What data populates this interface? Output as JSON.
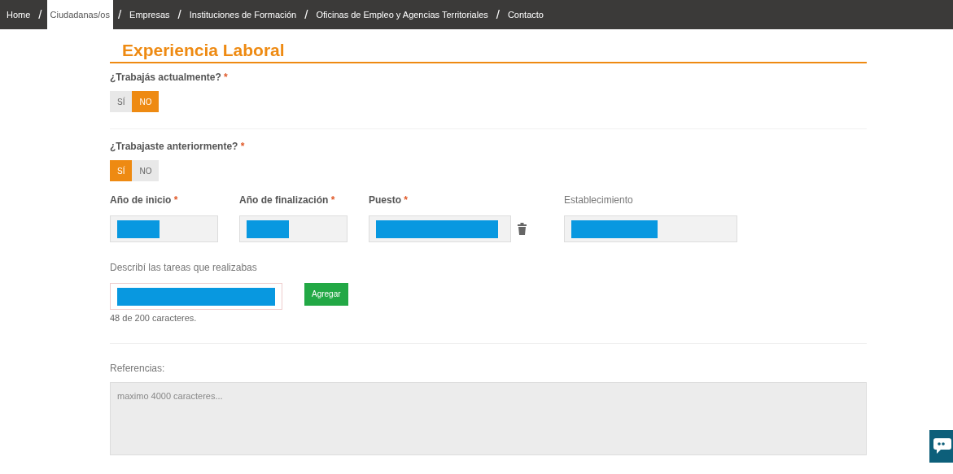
{
  "nav": [
    {
      "label": "Home",
      "selected": false
    },
    {
      "label": "Ciudadanas/os",
      "selected": true
    },
    {
      "label": "Empresas",
      "selected": false
    },
    {
      "label": "Instituciones de Formación",
      "selected": false
    },
    {
      "label": "Oficinas de Empleo y Agencias Territoriales",
      "selected": false
    },
    {
      "label": "Contacto",
      "selected": false
    }
  ],
  "nav_separator": "/",
  "heading": "Experiencia Laboral",
  "questions": [
    {
      "label": "¿Trabajás actualmente?",
      "required": true,
      "options": [
        {
          "label": "SÍ",
          "selected": false
        },
        {
          "label": "NO",
          "selected": true
        }
      ]
    },
    {
      "label": "¿Trabajaste anteriormente?",
      "required": true,
      "options": [
        {
          "label": "SÍ",
          "selected": true
        },
        {
          "label": "NO",
          "selected": false
        }
      ]
    }
  ],
  "required_mark": "*",
  "fields": [
    {
      "label": "Año de inicio",
      "required": true
    },
    {
      "label": "Año de finalización",
      "required": true
    },
    {
      "label": "Puesto",
      "required": true,
      "deletable": true
    },
    {
      "label": "Establecimiento",
      "required": false
    }
  ],
  "tasks": {
    "label": "Describí las tareas que realizabas",
    "button": "Agregar",
    "counter": "48 de 200 caracteres."
  },
  "references": {
    "label": "Referencias:",
    "placeholder": "maximo 4000 caracteres..."
  }
}
